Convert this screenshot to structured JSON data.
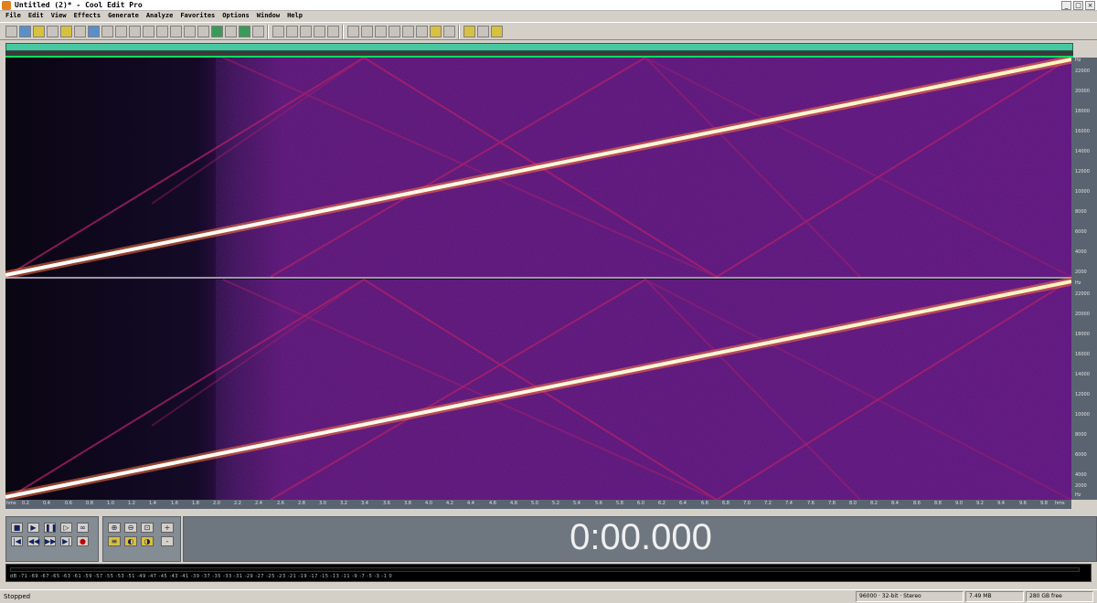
{
  "window": {
    "title": "Untitled (2)* - Cool Edit Pro"
  },
  "window_controls": {
    "minimize": "_",
    "maximize": "□",
    "close": "×"
  },
  "menu": [
    "File",
    "Edit",
    "View",
    "Effects",
    "Generate",
    "Analyze",
    "Favorites",
    "Options",
    "Window",
    "Help"
  ],
  "vertical_ruler_top": [
    "Hz",
    "22000",
    "20000",
    "18000",
    "16000",
    "14000",
    "12000",
    "10000",
    "8000",
    "6000",
    "4000",
    "2000"
  ],
  "vertical_ruler_bottom": [
    "Hz",
    "22000",
    "20000",
    "18000",
    "16000",
    "14000",
    "12000",
    "10000",
    "8000",
    "6000",
    "4000",
    "2000",
    "Hz"
  ],
  "time_ruler": [
    "hms",
    "0.2",
    "0.4",
    "0.6",
    "0.8",
    "1.0",
    "1.2",
    "1.4",
    "1.6",
    "1.8",
    "2.0",
    "2.2",
    "2.4",
    "2.6",
    "2.8",
    "3.0",
    "3.2",
    "3.4",
    "3.6",
    "3.8",
    "4.0",
    "4.2",
    "4.4",
    "4.6",
    "4.8",
    "5.0",
    "5.2",
    "5.4",
    "5.6",
    "5.8",
    "6.0",
    "6.2",
    "6.4",
    "6.6",
    "6.8",
    "7.0",
    "7.2",
    "7.4",
    "7.6",
    "7.8",
    "8.0",
    "8.2",
    "8.4",
    "8.6",
    "8.8",
    "9.0",
    "9.2",
    "9.4",
    "9.6",
    "9.8",
    "hms"
  ],
  "transport": {
    "stop": "■",
    "play": "▶",
    "pause": "❚❚",
    "play_from_cursor": "▷",
    "loop": "∞",
    "go_start": "|◀",
    "rewind": "◀◀",
    "forward": "▶▶",
    "go_end": "▶|",
    "record": "●"
  },
  "zoom": {
    "zoom_in_h": "⊕",
    "zoom_out_h": "⊖",
    "zoom_full": "⊡",
    "zoom_in_v": "+",
    "zoom_out_v": "-",
    "zoom_sel": "≡",
    "zoom_left": "◐",
    "zoom_right": "◑",
    "zoom_full_v": "□"
  },
  "time_display": "0:00.000",
  "level_scale": "dB -71 -69 -67 -65 -63 -61 -59 -57 -55 -53 -51 -49 -47 -45 -43 -41 -39 -37 -35 -33 -31 -29 -27 -25 -23 -21 -19 -17 -15 -13 -11 -9 -7 -5 -3 -1 0",
  "status": {
    "state": "Stopped",
    "format": "96000 · 32-bit · Stereo",
    "size": "7.49 MB",
    "free": "280 GB free"
  }
}
